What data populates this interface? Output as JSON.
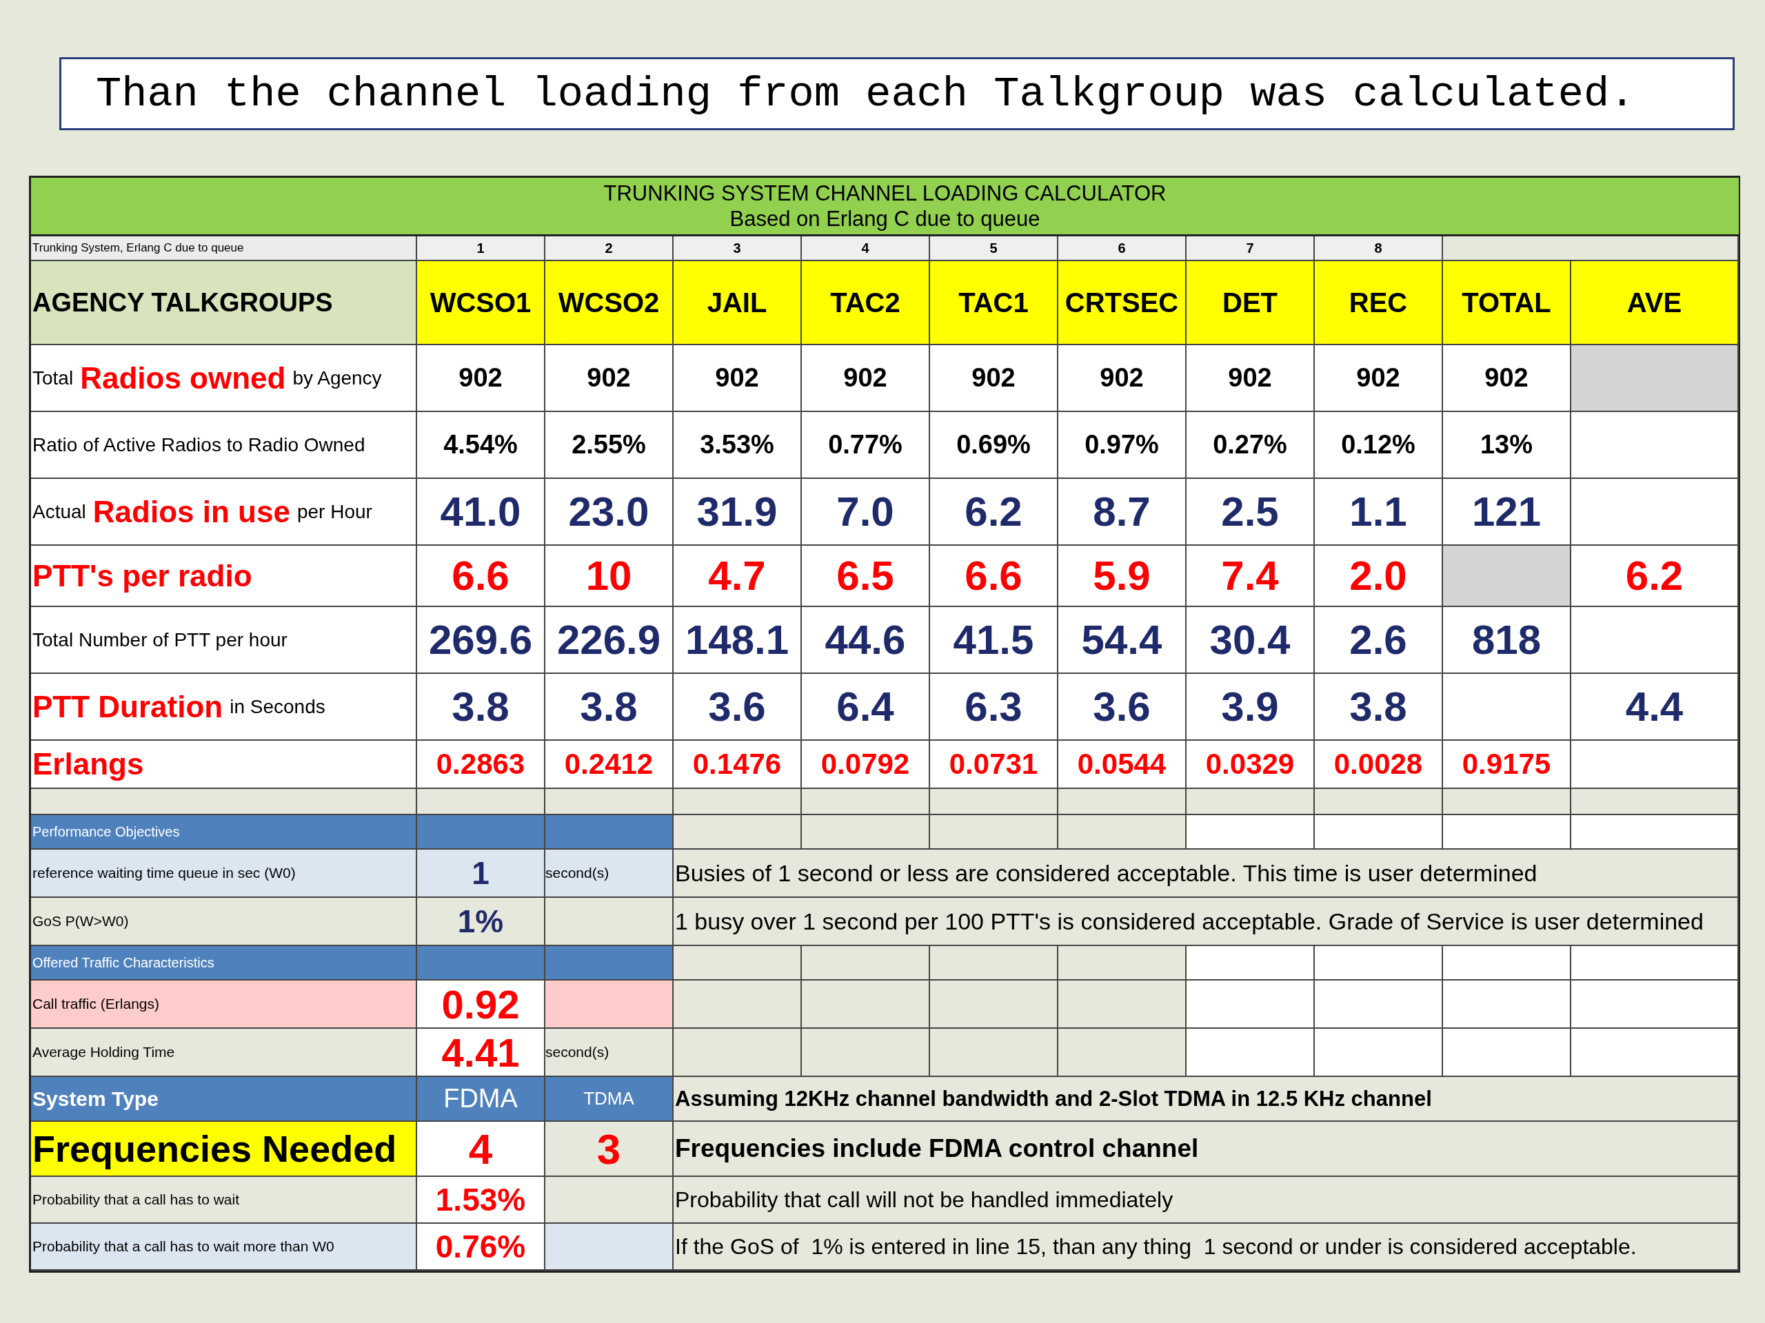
{
  "slide_title": "Than the channel loading from each Talkgroup was calculated.",
  "calculator": {
    "title_lines": [
      "TRUNKING SYSTEM CHANNEL LOADING CALCULATOR",
      "Based on Erlang C due to queue"
    ],
    "sheet_label": "Trunking System, Erlang C due to queue",
    "column_numbers": [
      "1",
      "2",
      "3",
      "4",
      "5",
      "6",
      "7",
      "8"
    ],
    "header": {
      "label": "AGENCY TALKGROUPS",
      "columns": [
        "WCSO1",
        "WCSO2",
        "JAIL",
        "TAC2",
        "TAC1",
        "CRTSEC",
        "DET",
        "REC",
        "TOTAL",
        "AVE"
      ]
    },
    "rows": [
      {
        "kind": "plain",
        "label": {
          "prefix": "Total",
          "emphasis": "Radios owned",
          "suffix": "by Agency"
        },
        "cells": [
          {
            "text": "902"
          },
          {
            "text": "902"
          },
          {
            "text": "902"
          },
          {
            "text": "902"
          },
          {
            "text": "902"
          },
          {
            "text": "902"
          },
          {
            "text": "902"
          },
          {
            "text": "902"
          },
          {
            "text": "902"
          },
          {
            "shaded": true
          }
        ]
      },
      {
        "kind": "plain",
        "label": {
          "prefix": "Ratio of Active Radios to Radio Owned"
        },
        "cells": [
          {
            "text": "4.54%"
          },
          {
            "text": "2.55%"
          },
          {
            "text": "3.53%"
          },
          {
            "text": "0.77%"
          },
          {
            "text": "0.69%"
          },
          {
            "text": "0.97%"
          },
          {
            "text": "0.27%"
          },
          {
            "text": "0.12%"
          },
          {
            "text": "13%"
          },
          {
            "shaded": false
          }
        ]
      },
      {
        "kind": "big_navy",
        "label": {
          "prefix": "Actual",
          "emphasis": "Radios in use",
          "suffix": "per Hour"
        },
        "cells": [
          {
            "text": "41.0"
          },
          {
            "text": "23.0"
          },
          {
            "text": "31.9"
          },
          {
            "text": "7.0"
          },
          {
            "text": "6.2"
          },
          {
            "text": "8.7"
          },
          {
            "text": "2.5"
          },
          {
            "text": "1.1"
          },
          {
            "text": "121"
          },
          {
            "shaded": false
          }
        ]
      },
      {
        "kind": "big_red",
        "label": {
          "emphasis": "PTT's per radio"
        },
        "cells": [
          {
            "text": "6.6"
          },
          {
            "text": "10"
          },
          {
            "text": "4.7"
          },
          {
            "text": "6.5"
          },
          {
            "text": "6.6"
          },
          {
            "text": "5.9"
          },
          {
            "text": "7.4"
          },
          {
            "text": "2.0"
          },
          {
            "shaded": true
          },
          {
            "text": "6.2"
          }
        ]
      },
      {
        "kind": "big_navy",
        "label": {
          "prefix": "Total Number of PTT per hour"
        },
        "cells": [
          {
            "text": "269.6"
          },
          {
            "text": "226.9"
          },
          {
            "text": "148.1"
          },
          {
            "text": "44.6"
          },
          {
            "text": "41.5"
          },
          {
            "text": "54.4"
          },
          {
            "text": "30.4"
          },
          {
            "text": "2.6"
          },
          {
            "text": "818"
          },
          {
            "shaded": false
          }
        ]
      },
      {
        "kind": "big_navy",
        "label": {
          "emphasis": "PTT Duration",
          "suffix": "in Seconds"
        },
        "cells": [
          {
            "text": "3.8"
          },
          {
            "text": "3.8"
          },
          {
            "text": "3.6"
          },
          {
            "text": "6.4"
          },
          {
            "text": "6.3"
          },
          {
            "text": "3.6"
          },
          {
            "text": "3.9"
          },
          {
            "text": "3.8"
          },
          {
            "shaded": false
          },
          {
            "text": "4.4"
          }
        ]
      },
      {
        "kind": "red",
        "label": {
          "emphasis": "Erlangs"
        },
        "cells": [
          {
            "text": "0.2863"
          },
          {
            "text": "0.2412"
          },
          {
            "text": "0.1476"
          },
          {
            "text": "0.0792"
          },
          {
            "text": "0.0731"
          },
          {
            "text": "0.0544"
          },
          {
            "text": "0.0329"
          },
          {
            "text": "0.0028"
          },
          {
            "text": "0.9175"
          },
          {
            "shaded": false
          }
        ]
      }
    ],
    "lower_rows": [
      {
        "kind": "section",
        "label": "Performance Objectives"
      },
      {
        "kind": "objective",
        "highlight": true,
        "label": "reference waiting time queue in sec (W0)",
        "value": "1",
        "unit": "second(s)",
        "note": "Busies of 1 second or less are considered acceptable. This time is user determined"
      },
      {
        "kind": "objective",
        "highlight": false,
        "label": "GoS P(W>W0)",
        "value": "1%",
        "note": "1 busy over 1 second per 100 PTT's is considered acceptable. Grade of Service is user determined"
      },
      {
        "kind": "section",
        "label": "Offered Traffic Characteristics"
      },
      {
        "kind": "input",
        "highlight": true,
        "label": "Call traffic (Erlangs)",
        "value": "0.92"
      },
      {
        "kind": "input",
        "highlight": false,
        "label": "Average Holding Time",
        "value": "4.41",
        "unit": "second(s)"
      },
      {
        "kind": "system",
        "label": "System Type",
        "value": "FDMA",
        "value_2": "TDMA",
        "note": "Assuming 12KHz channel bandwidth and 2-Slot TDMA in 12.5 KHz channel"
      },
      {
        "kind": "result",
        "label": "Frequencies Needed",
        "value": "4",
        "value_2": "3",
        "note": "Frequencies include FDMA control channel"
      },
      {
        "kind": "probability",
        "highlight": false,
        "label": "Probability that a call has to wait",
        "value": "1.53%",
        "note": "Probability that call will not be handled immediately"
      },
      {
        "kind": "probability",
        "highlight": true,
        "label": "Probability that a call has to wait more than W0",
        "value": "0.76%",
        "note": "If the GoS of  1% is entered in line 15, than any thing  1 second or under is considered acceptable."
      }
    ]
  }
}
